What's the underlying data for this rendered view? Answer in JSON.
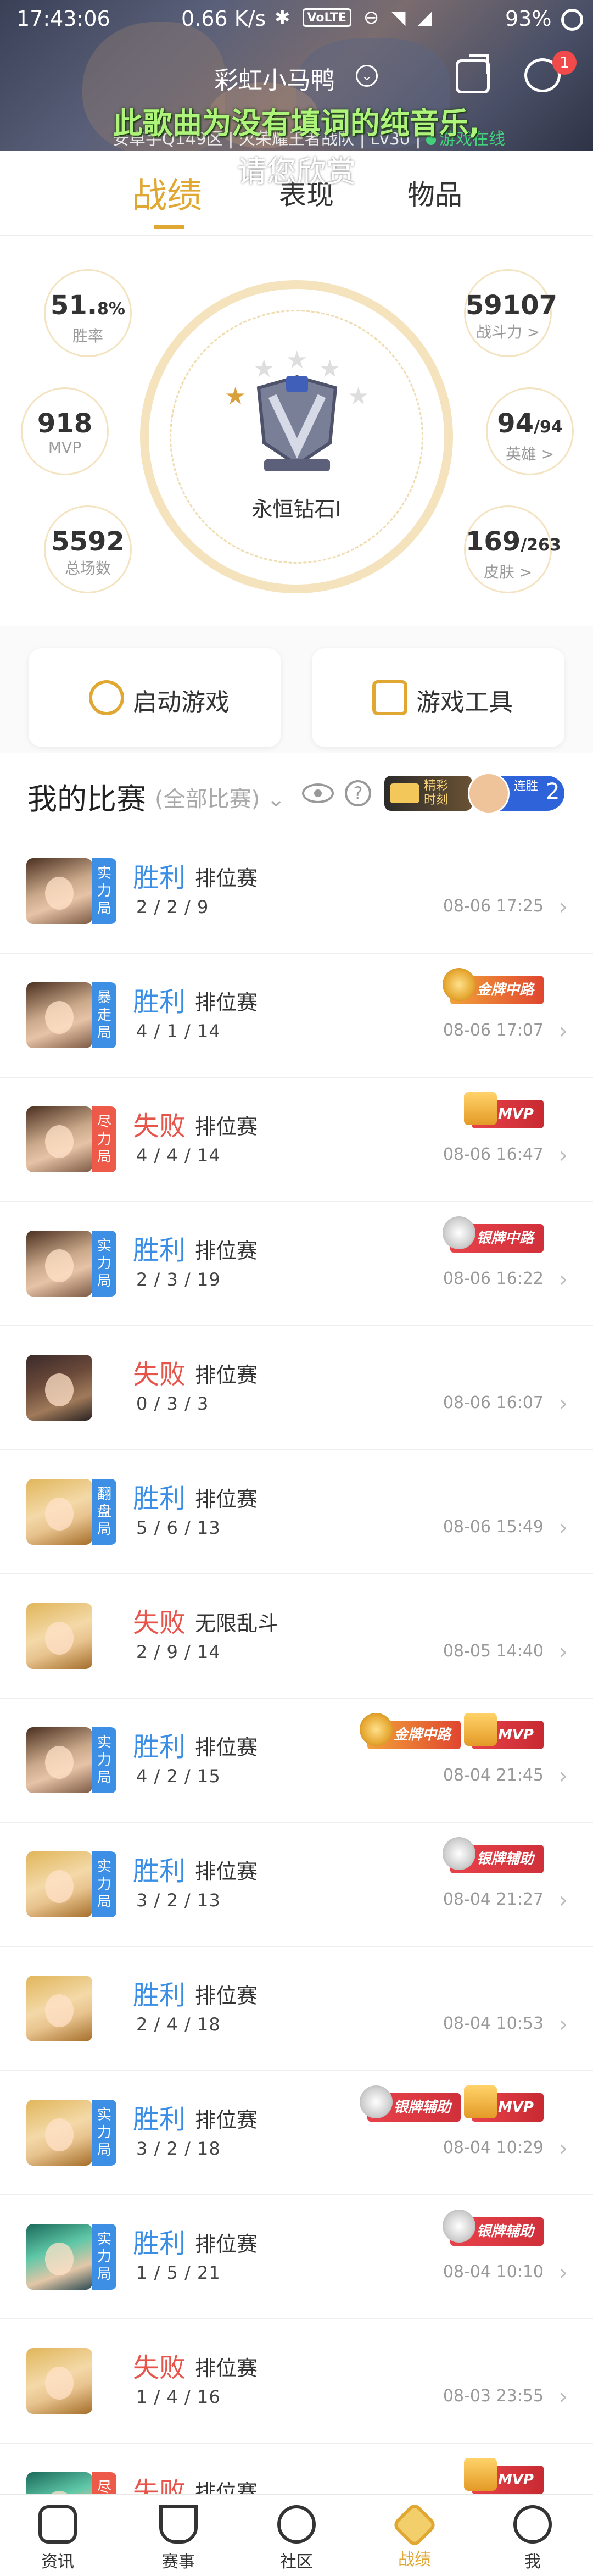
{
  "status_bar": {
    "time": "17:43:06",
    "net_speed": "0.66 K/s",
    "volte": "VoLTE",
    "battery": "93%"
  },
  "header": {
    "nickname": "彩虹小马鸭",
    "notice": "此歌曲为没有填词的纯音乐,",
    "notice2": "请您欣赏",
    "subinfo": "安卓手Q149区 | 火荣耀王者战队 | Lv30 | ",
    "online": "游戏在线",
    "chat_badge": "1"
  },
  "tabs": [
    "战绩",
    "表现",
    "物品"
  ],
  "stats": {
    "win_rate": {
      "value": "51.",
      "suffix": "8%",
      "label": "胜率"
    },
    "mvp": {
      "value": "918",
      "label": "MVP"
    },
    "total": {
      "value": "5592",
      "label": "总场数"
    },
    "power": {
      "value": "59107",
      "label": "战斗力 >"
    },
    "heroes": {
      "value": "94",
      "suffix": "/94",
      "label": "英雄 >"
    },
    "skins": {
      "value": "169",
      "suffix": "/263",
      "label": "皮肤 >"
    },
    "rank": "永恒钻石I",
    "rank_stars_lit": 1,
    "rank_stars_total": 5
  },
  "actions": {
    "launch": "启动游戏",
    "tools": "游戏工具"
  },
  "match_section": {
    "title": "我的比赛",
    "filter": "(全部比赛)",
    "highlight_top": "精彩",
    "highlight_bottom": "时刻",
    "streak_label_top": "连胜",
    "streak_num": "2"
  },
  "matches": [
    {
      "hero": "h1",
      "tag": "实力局",
      "tag_color": "blue",
      "result": "胜利",
      "win": true,
      "type": "排位赛",
      "kda": "2 / 2 / 9",
      "date": "08-06 17:25",
      "badges": []
    },
    {
      "hero": "h1",
      "tag": "暴走局",
      "tag_color": "blue",
      "result": "胜利",
      "win": true,
      "type": "排位赛",
      "kda": "4 / 1 / 14",
      "date": "08-06 17:07",
      "badges": [
        {
          "kind": "gold",
          "text": "金牌中路"
        }
      ]
    },
    {
      "hero": "h1",
      "tag": "尽力局",
      "tag_color": "red",
      "result": "失败",
      "win": false,
      "type": "排位赛",
      "kda": "4 / 4 / 14",
      "date": "08-06 16:47",
      "badges": [
        {
          "kind": "mvp",
          "text": "MVP"
        }
      ]
    },
    {
      "hero": "h1",
      "tag": "实力局",
      "tag_color": "blue",
      "result": "胜利",
      "win": true,
      "type": "排位赛",
      "kda": "2 / 3 / 19",
      "date": "08-06 16:22",
      "badges": [
        {
          "kind": "silver",
          "text": "银牌中路"
        }
      ]
    },
    {
      "hero": "h2",
      "tag": "",
      "tag_color": "",
      "result": "失败",
      "win": false,
      "type": "排位赛",
      "kda": "0 / 3 / 3",
      "date": "08-06 16:07",
      "badges": []
    },
    {
      "hero": "h3",
      "tag": "翻盘局",
      "tag_color": "blue",
      "result": "胜利",
      "win": true,
      "type": "排位赛",
      "kda": "5 / 6 / 13",
      "date": "08-06 15:49",
      "badges": []
    },
    {
      "hero": "h3",
      "tag": "",
      "tag_color": "",
      "result": "失败",
      "win": false,
      "type": "无限乱斗",
      "kda": "2 / 9 / 14",
      "date": "08-05 14:40",
      "badges": []
    },
    {
      "hero": "h1",
      "tag": "实力局",
      "tag_color": "blue",
      "result": "胜利",
      "win": true,
      "type": "排位赛",
      "kda": "4 / 2 / 15",
      "date": "08-04 21:45",
      "badges": [
        {
          "kind": "gold",
          "text": "金牌中路"
        },
        {
          "kind": "mvp",
          "text": "MVP"
        }
      ]
    },
    {
      "hero": "h3",
      "tag": "实力局",
      "tag_color": "blue",
      "result": "胜利",
      "win": true,
      "type": "排位赛",
      "kda": "3 / 2 / 13",
      "date": "08-04 21:27",
      "badges": [
        {
          "kind": "silver",
          "text": "银牌辅助"
        }
      ]
    },
    {
      "hero": "h3",
      "tag": "",
      "tag_color": "",
      "result": "胜利",
      "win": true,
      "type": "排位赛",
      "kda": "2 / 4 / 18",
      "date": "08-04 10:53",
      "badges": []
    },
    {
      "hero": "h3",
      "tag": "实力局",
      "tag_color": "blue",
      "result": "胜利",
      "win": true,
      "type": "排位赛",
      "kda": "3 / 2 / 18",
      "date": "08-04 10:29",
      "badges": [
        {
          "kind": "silver",
          "text": "银牌辅助"
        },
        {
          "kind": "mvp",
          "text": "MVP"
        }
      ]
    },
    {
      "hero": "h4",
      "tag": "实力局",
      "tag_color": "blue",
      "result": "胜利",
      "win": true,
      "type": "排位赛",
      "kda": "1 / 5 / 21",
      "date": "08-04 10:10",
      "badges": [
        {
          "kind": "silver",
          "text": "银牌辅助"
        }
      ]
    },
    {
      "hero": "h3",
      "tag": "",
      "tag_color": "",
      "result": "失败",
      "win": false,
      "type": "排位赛",
      "kda": "1 / 4 / 16",
      "date": "08-03 23:55",
      "badges": []
    },
    {
      "hero": "h4",
      "tag": "尽力局",
      "tag_color": "red",
      "result": "失败",
      "win": false,
      "type": "排位赛",
      "kda": "",
      "date": "",
      "badges": [
        {
          "kind": "mvp",
          "text": "MVP"
        }
      ]
    }
  ],
  "bottom_nav": [
    {
      "label": "资讯",
      "icon": "news-icon",
      "active": false
    },
    {
      "label": "赛事",
      "icon": "trophy-icon",
      "active": false
    },
    {
      "label": "社区",
      "icon": "community-icon",
      "active": false
    },
    {
      "label": "战绩",
      "icon": "record-icon",
      "active": true
    },
    {
      "label": "我",
      "icon": "profile-icon",
      "active": false
    }
  ],
  "colors": {
    "accent": "#e0a833",
    "win": "#3a8ee6",
    "lose": "#e6544a"
  }
}
